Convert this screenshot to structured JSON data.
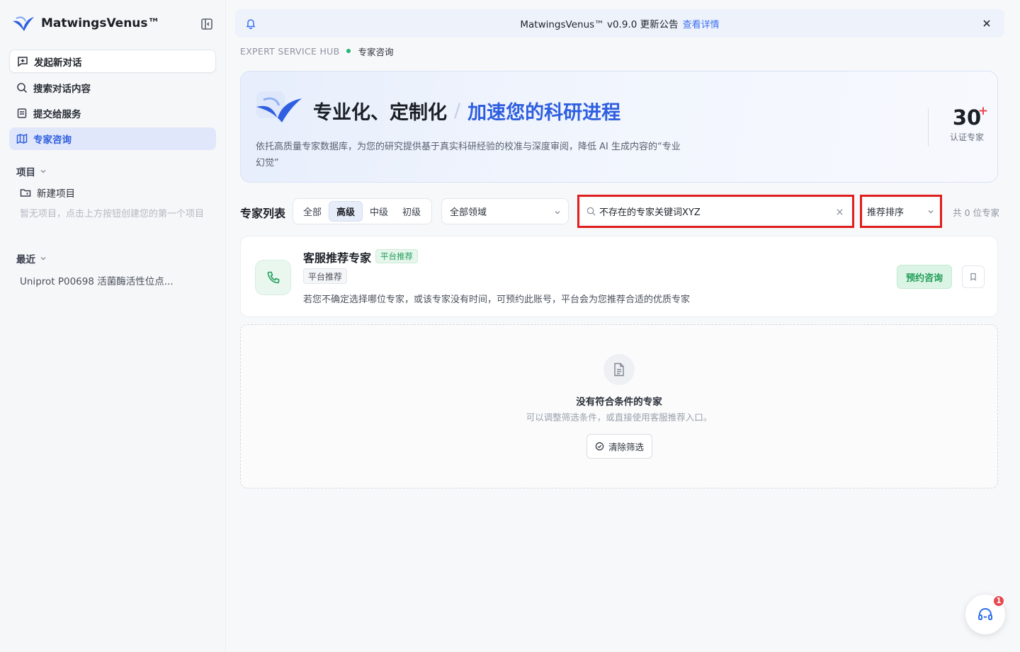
{
  "app": {
    "brand": "MatwingsVenus™"
  },
  "sidebar": {
    "new_chat": "发起新对话",
    "nav": [
      {
        "label": "搜索对话内容",
        "icon": "search-icon"
      },
      {
        "label": "提交给服务",
        "icon": "form-icon"
      },
      {
        "label": "专家咨询",
        "icon": "map-icon",
        "active": true
      }
    ],
    "projects_label": "项目",
    "new_project": "新建项目",
    "projects_hint": "暂无项目，点击上方按钮创建您的第一个项目",
    "recent_label": "最近",
    "recent_items": [
      "Uniprot P00698 活菌酶活性位点..."
    ]
  },
  "notice": {
    "text": "MatwingsVenus™ v0.9.0 更新公告",
    "link": "查看详情"
  },
  "breadcrumb": {
    "section": "EXPERT SERVICE HUB",
    "current": "专家咨询"
  },
  "hero": {
    "title_main": "专业化、定制化",
    "title_sep": "/",
    "title_accent": "加速您的科研进程",
    "desc": "依托高质量专家数据库，为您的研究提供基于真实科研经验的校准与深度审阅，降低 AI 生成内容的“专业幻觉”",
    "stat_value": "30",
    "stat_plus": "+",
    "stat_label": "认证专家"
  },
  "filters": {
    "title": "专家列表",
    "levels": [
      "全部",
      "高级",
      "中级",
      "初级"
    ],
    "active_level": "高级",
    "domain": "全部领域",
    "search_value": "不存在的专家关键词XYZ",
    "sort": "推荐排序",
    "count": "共 0 位专家"
  },
  "expert_card": {
    "name": "客服推荐专家",
    "badge": "平台推荐",
    "tag": "平台推荐",
    "desc": "若您不确定选择哪位专家，或该专家没有时间，可预约此账号，平台会为您推荐合适的优质专家",
    "book": "预约咨询"
  },
  "empty": {
    "title": "没有符合条件的专家",
    "subtitle": "可以调整筛选条件，或直接使用客服推荐入口。",
    "clear": "清除筛选"
  },
  "help": {
    "badge": "1"
  },
  "colors": {
    "accent": "#2f5fe0",
    "green": "#1f9d57",
    "highlight": "#e01e1e"
  }
}
